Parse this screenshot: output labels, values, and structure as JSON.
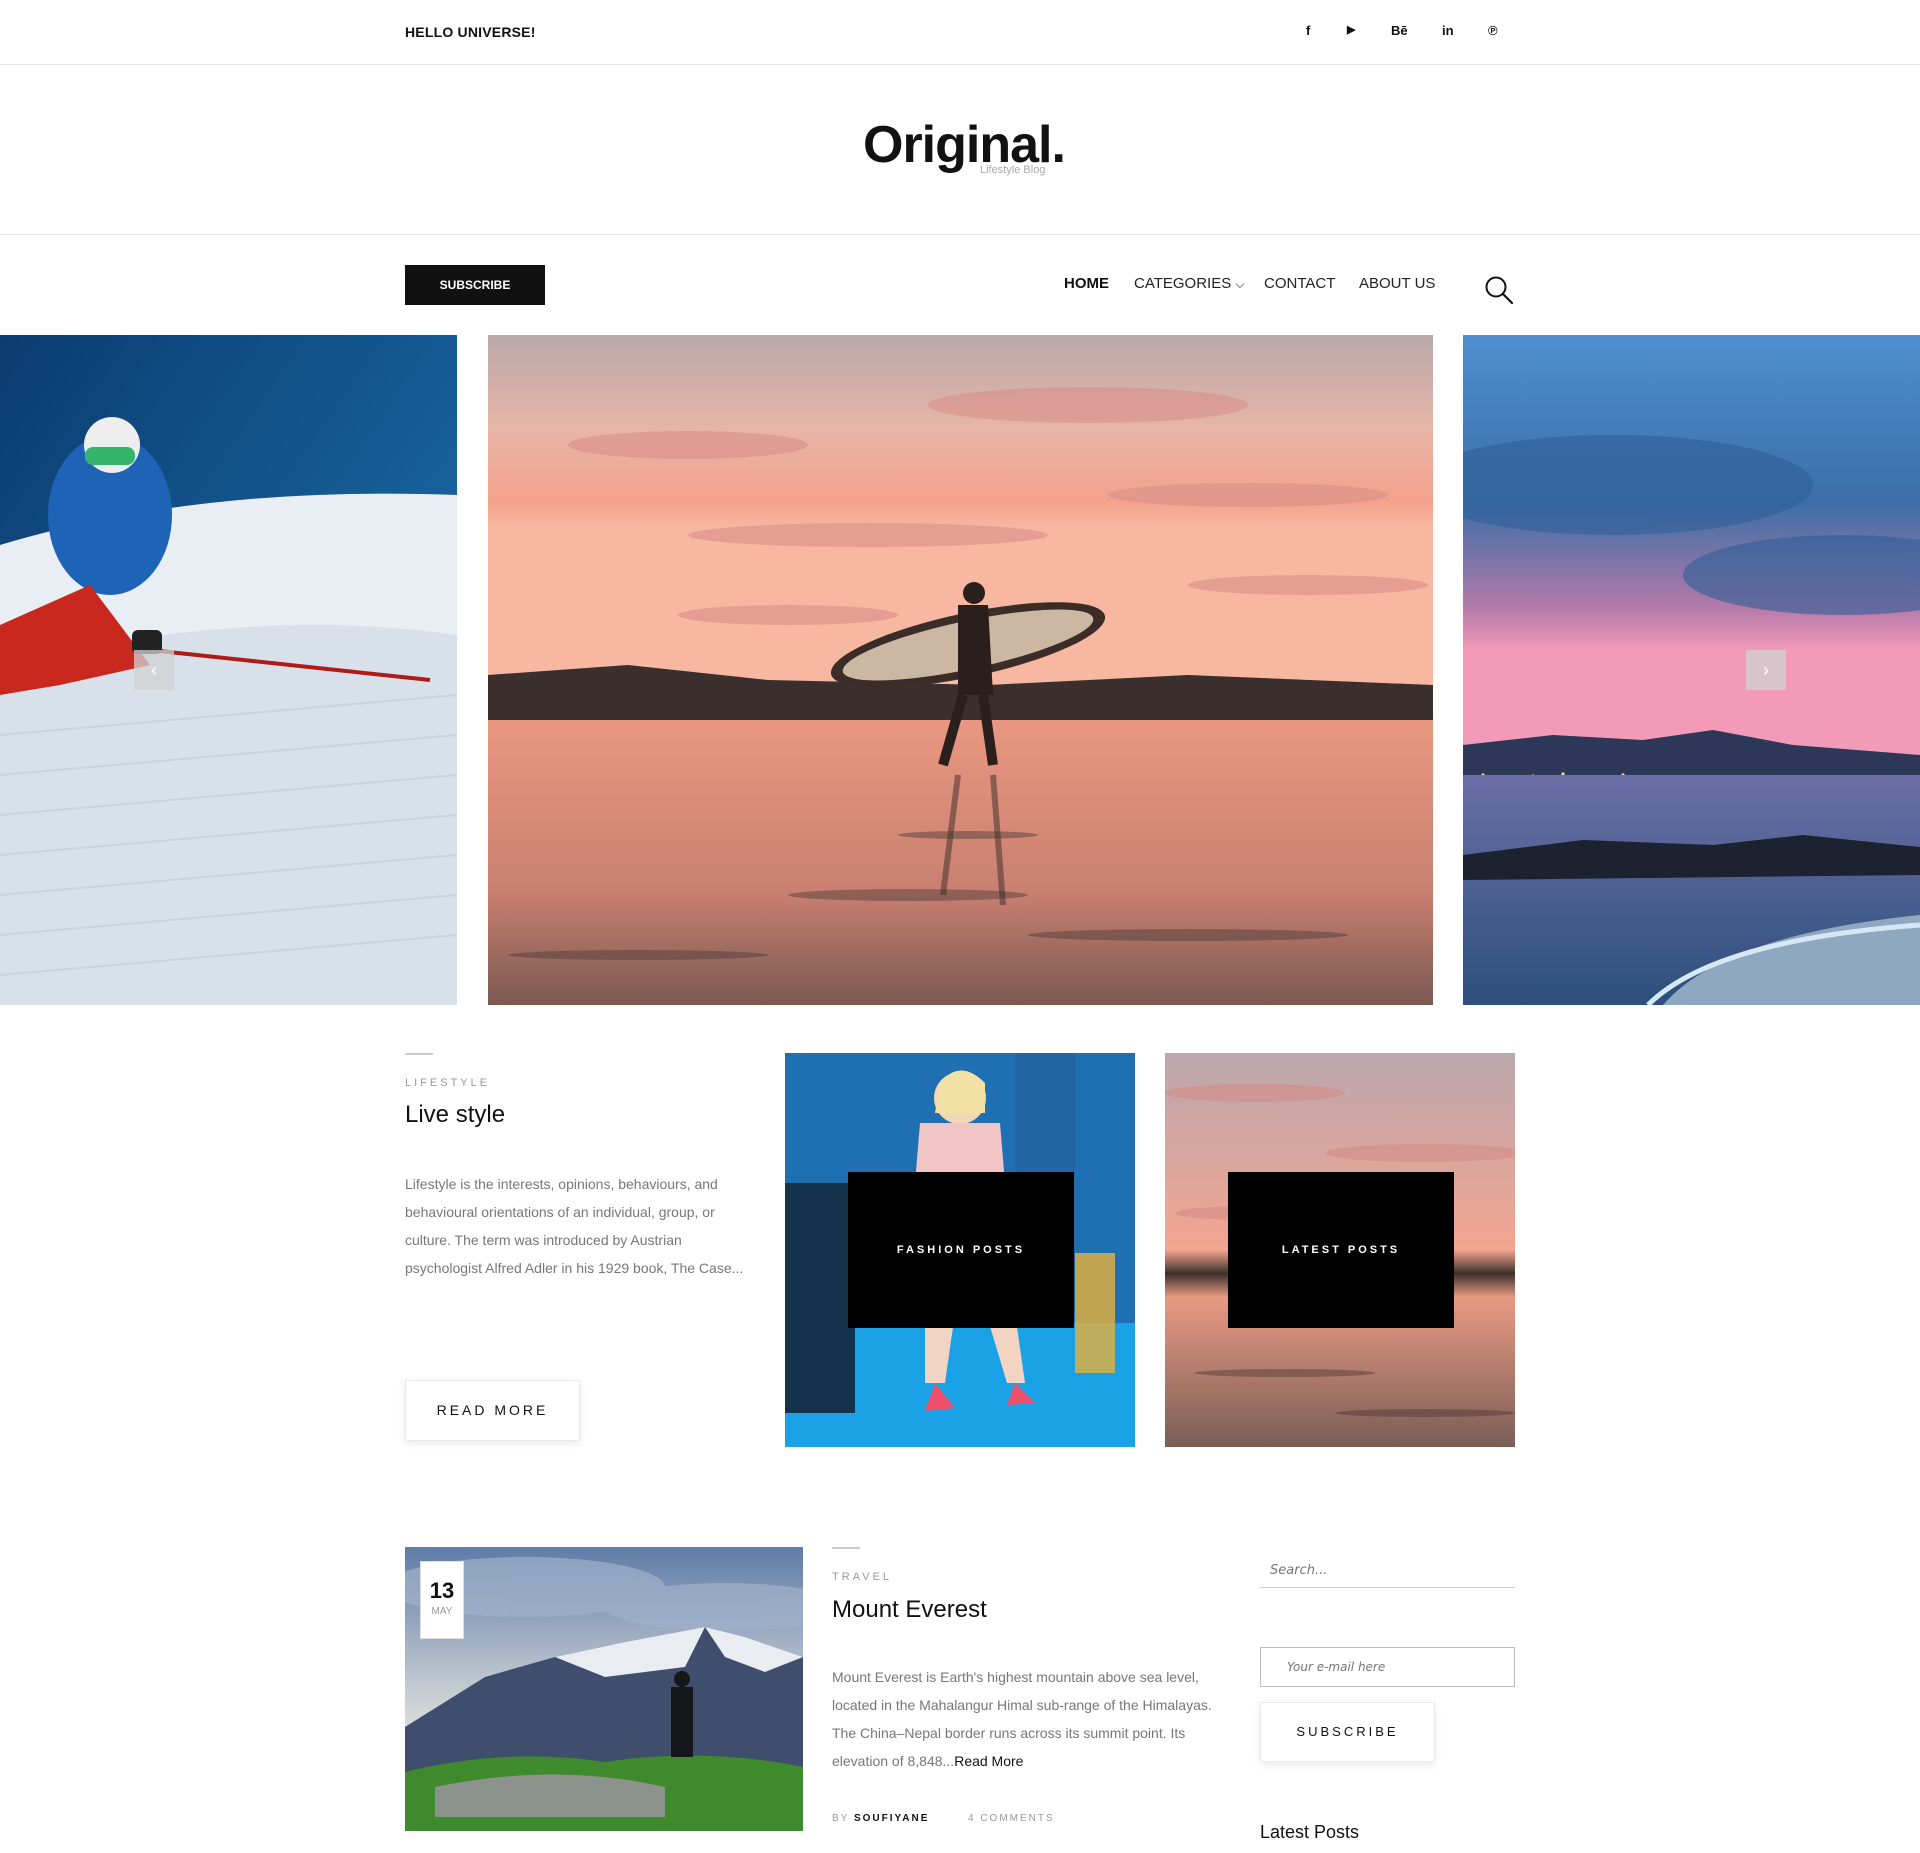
{
  "topbar": {
    "greeting": "HELLO UNIVERSE!",
    "social": [
      {
        "icon": "facebook-icon",
        "label": "f"
      },
      {
        "icon": "youtube-icon",
        "label": "▶"
      },
      {
        "icon": "behance-icon",
        "label": "Bē"
      },
      {
        "icon": "linkedin-icon",
        "label": "in"
      },
      {
        "icon": "pinterest-icon",
        "label": "℗"
      }
    ]
  },
  "brand": {
    "logo": "Original.",
    "tagline": "Lifestyle Blog"
  },
  "nav": {
    "subscribe_label": "SUBSCRIBE",
    "items": [
      "HOME",
      "CATEGORIES",
      "CONTACT",
      "ABOUT US"
    ],
    "categories_caret": "⌵"
  },
  "slider": {
    "prev": "‹",
    "next": "›"
  },
  "featured": {
    "category": "LIFESTYLE",
    "title": "Live style",
    "excerpt": "Lifestyle is the interests, opinions, behaviours, and behavioural orientations of an individual, group, or culture. The term was introduced by Austrian psychologist Alfred Adler in his 1929 book, The Case...",
    "read_more": "READ MORE",
    "cards": [
      "FASHION POSTS",
      "LATEST POSTS"
    ]
  },
  "post": {
    "day": "13",
    "month": "MAY",
    "category": "TRAVEL",
    "title": "Mount Everest",
    "excerpt": "Mount Everest is Earth's highest mountain above sea level, located in the Mahalangur Himal sub-range of the Himalayas. The China–Nepal border runs across its summit point. Its elevation of 8,848...",
    "read_more": "Read More",
    "by_label": "BY",
    "author": "SOUFIYANE",
    "comments": "4 COMMENTS"
  },
  "sidebar": {
    "search_placeholder": "Search...",
    "email_placeholder": "Your e-mail here",
    "subscribe_label": "SUBSCRIBE",
    "latest_heading": "Latest Posts"
  }
}
